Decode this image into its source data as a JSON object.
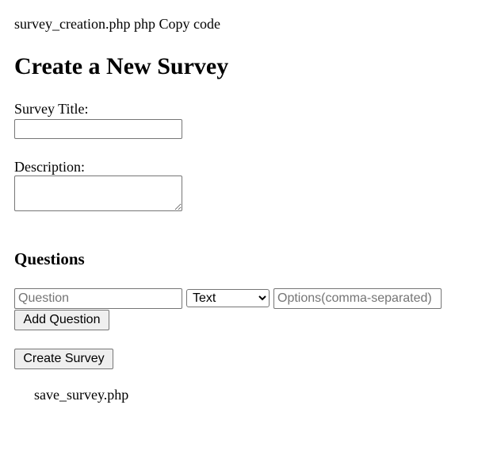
{
  "header_text": "survey_creation.php php Copy code",
  "title": "Create a New Survey",
  "form": {
    "survey_title_label": "Survey Title:",
    "survey_title_value": "",
    "description_label": "Description:",
    "description_value": "",
    "questions_heading": "Questions",
    "question_placeholder": "Question",
    "type_selected": "Text",
    "options_placeholder": "Options(comma-separated)",
    "add_question_label": "Add Question",
    "create_survey_label": "Create Survey"
  },
  "footer_text": "save_survey.php"
}
